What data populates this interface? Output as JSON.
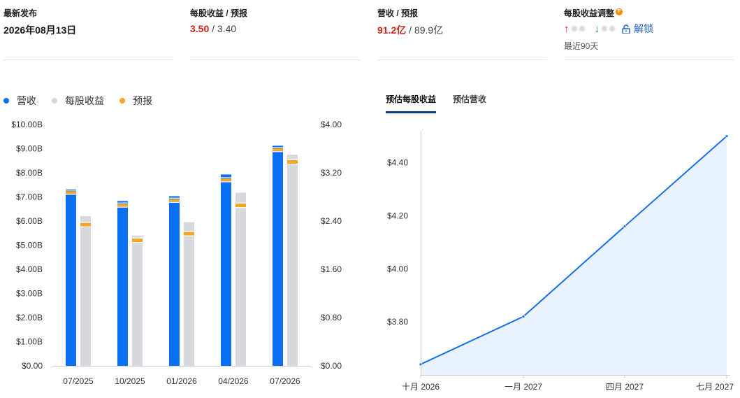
{
  "cards": {
    "release": {
      "title": "最新发布",
      "value": "2026年08月13日"
    },
    "eps": {
      "title": "每股收益 / 预报",
      "actual": "3.50",
      "separator": " / ",
      "forecast": "3.40"
    },
    "revenue": {
      "title": "营收 / 预报",
      "actual": "91.2亿",
      "separator": " / ",
      "forecast": "89.9亿"
    },
    "adjust": {
      "title": "每股收益调整",
      "pro_badge": "P",
      "unlock_label": "解锁",
      "period": "最近90天",
      "up_icon": "arrow-up-icon",
      "down_icon": "arrow-down-icon",
      "lock_icon": "lock-icon"
    }
  },
  "legend": [
    {
      "label": "营收",
      "color": "#0b6ff2"
    },
    {
      "label": "每股收益",
      "color": "#d7d9dc"
    },
    {
      "label": "预报",
      "color": "#f5a623"
    }
  ],
  "tabs": [
    {
      "label": "预估每股收益",
      "active": true
    },
    {
      "label": "预估营收",
      "active": false
    }
  ],
  "chart_data": [
    {
      "type": "bar",
      "categories": [
        "07/2025",
        "10/2025",
        "01/2026",
        "04/2026",
        "07/2026"
      ],
      "left_axis": {
        "ticks": [
          "$0.00",
          "$1.00B",
          "$2.00B",
          "$3.00B",
          "$4.00B",
          "$5.00B",
          "$6.00B",
          "$7.00B",
          "$8.00B",
          "$9.00B",
          "$10.00B"
        ],
        "ylim": [
          0,
          10
        ]
      },
      "right_axis": {
        "ticks": [
          "$0.00",
          "$0.80",
          "$1.60",
          "$2.40",
          "$3.20",
          "$4.00"
        ],
        "ylim": [
          0,
          4
        ]
      },
      "series": [
        {
          "name": "营收",
          "axis": "left",
          "unit": "B",
          "color": "#0b6ff2",
          "values": [
            7.32,
            6.83,
            7.03,
            7.93,
            9.12
          ],
          "forecast": [
            7.18,
            6.65,
            6.85,
            7.7,
            8.95
          ]
        },
        {
          "name": "每股收益",
          "axis": "right",
          "color": "#d7d9dc",
          "values": [
            2.48,
            2.16,
            2.38,
            2.87,
            3.5
          ],
          "forecast": [
            2.34,
            2.08,
            2.19,
            2.66,
            3.38
          ]
        }
      ],
      "forecast_color": "#f5a623"
    },
    {
      "type": "area",
      "x": [
        "十月 2026",
        "一月 2027",
        "四月 2027",
        "七月 2027"
      ],
      "y": [
        3.64,
        3.82,
        4.16,
        4.5
      ],
      "y_ticks": [
        "$3.80",
        "$4.00",
        "$4.20",
        "$4.40"
      ],
      "ylim": [
        3.6,
        4.52
      ],
      "line_color": "#1671e6",
      "fill_color": "#eaf2fd"
    }
  ]
}
